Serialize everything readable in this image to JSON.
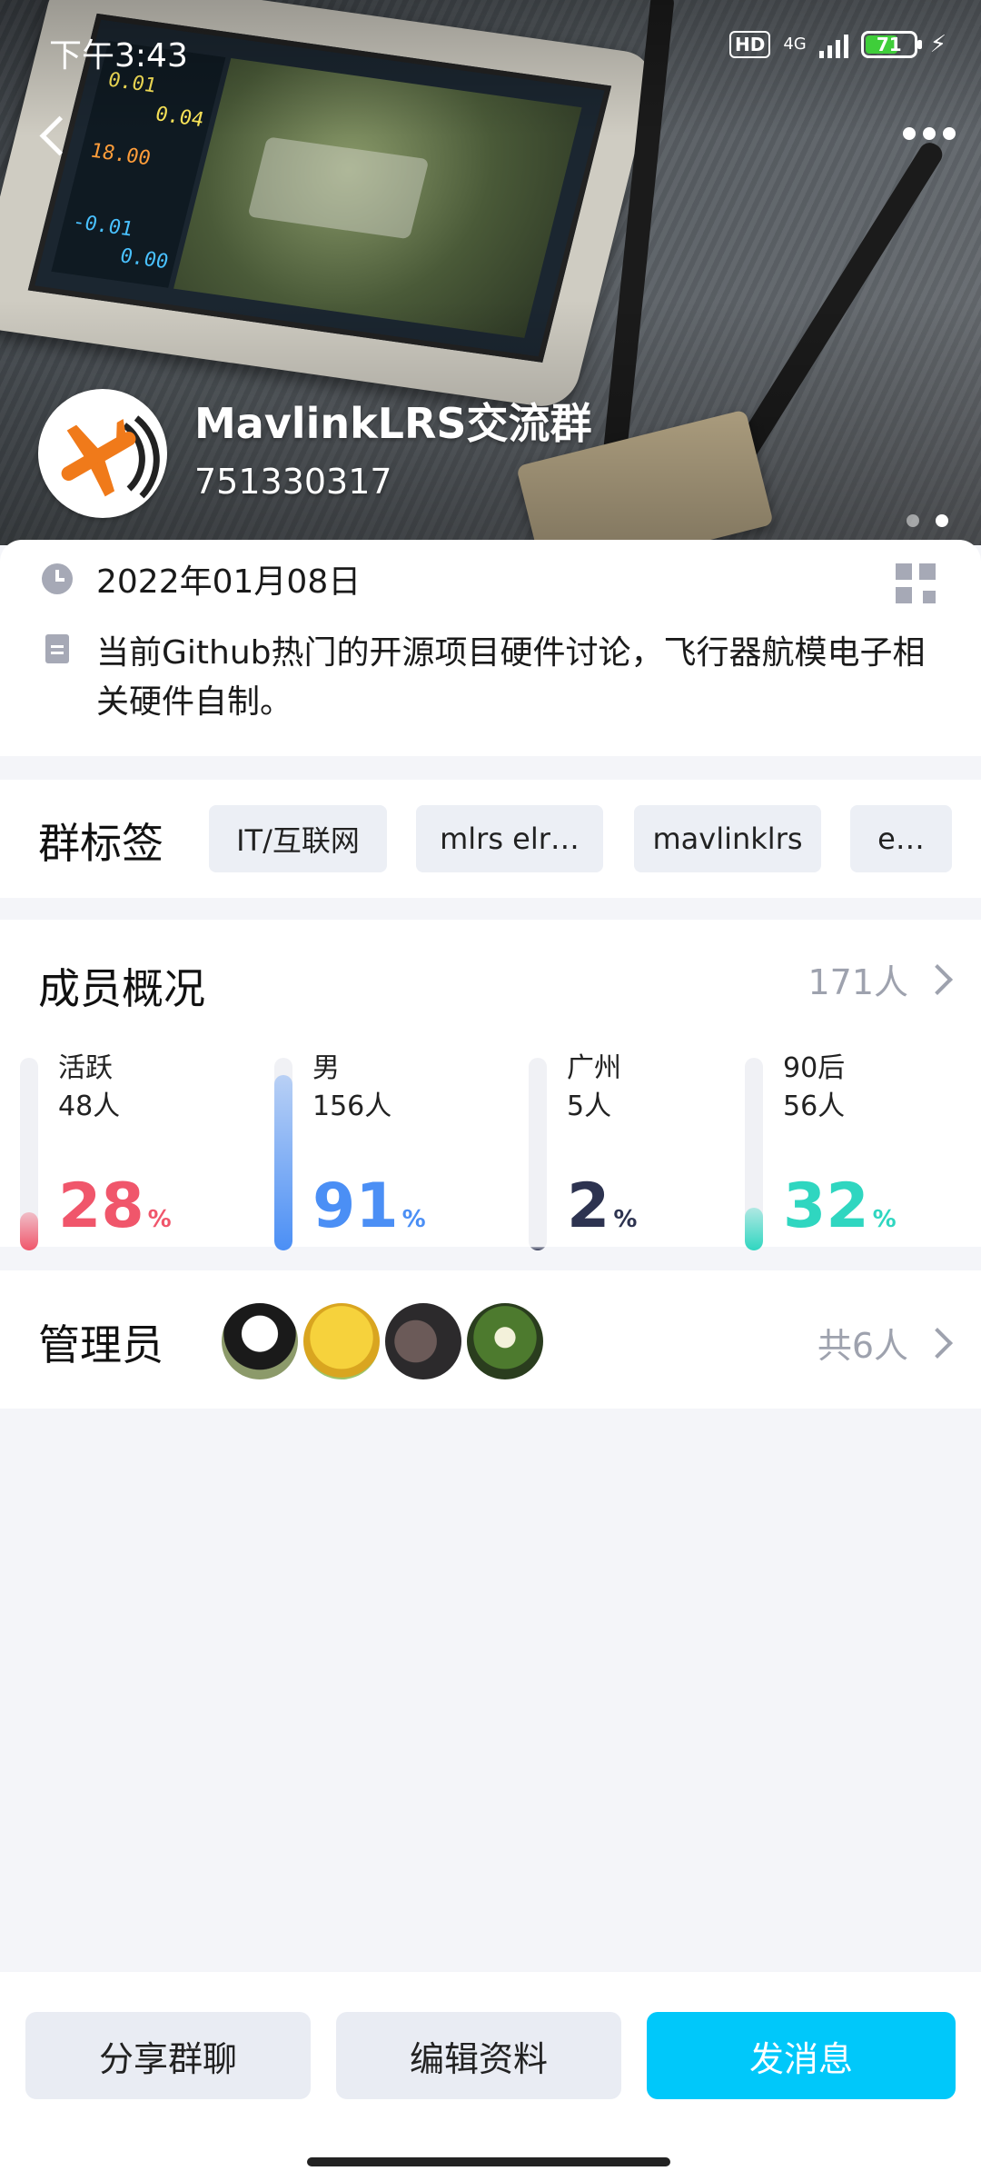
{
  "status": {
    "time": "下午3:43",
    "hd": "HD",
    "network": "4G",
    "battery": "71",
    "battery_level": 0.71,
    "colors": {
      "battery_fill": "#3fce3a"
    }
  },
  "header": {
    "back_icon": "chevron-left-icon",
    "more_icon": "more-dots-icon",
    "group_name": "MavlinkLRS交流群",
    "group_id": "751330317",
    "carousel_pages": 2,
    "carousel_active": 2
  },
  "info": {
    "created_date": "2022年01月08日",
    "description": "当前Github热门的开源项目硬件讨论，飞行器航模电子相关硬件自制。",
    "qr_icon": "qr-code-icon"
  },
  "tags": {
    "title": "群标签",
    "items": [
      "IT/互联网",
      "mlrs elr…",
      "mavlinklrs",
      "e…"
    ]
  },
  "members": {
    "title": "成员概况",
    "total": "171人",
    "stats": [
      {
        "label": "活跃",
        "count": "48人",
        "percent": "28",
        "unit": "%",
        "color": "#f0566b",
        "fill": 0.2
      },
      {
        "label": "男",
        "count": "156人",
        "percent": "91",
        "unit": "%",
        "color": "#4b8ff5",
        "fill": 0.91
      },
      {
        "label": "广州",
        "count": "5人",
        "percent": "2",
        "unit": "%",
        "color": "#2d3350",
        "fill": 0.02
      },
      {
        "label": "90后",
        "count": "56人",
        "percent": "32",
        "unit": "%",
        "color": "#2fd6c0",
        "fill": 0.22
      }
    ]
  },
  "admins": {
    "title": "管理员",
    "total": "共6人"
  },
  "actions": {
    "share": "分享群聊",
    "edit": "编辑资料",
    "send": "发消息",
    "colors": {
      "primary": "#00c8fa"
    }
  }
}
